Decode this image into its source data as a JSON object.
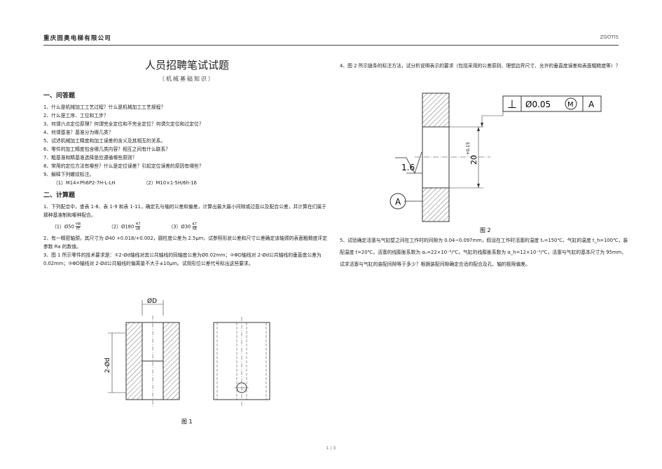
{
  "header": {
    "company": "重庆固奥电梯有限公司",
    "code": "ZGOTIS"
  },
  "title": "人员招聘笔试试题",
  "subtitle": "（机械基础知识）",
  "section1": {
    "heading": "一、问答题",
    "questions": [
      "1、什么是机械加工工艺过程？什么是机械加工工艺规程？",
      "2、什么是工序、工位和工步？",
      "3、何谓六点定位原理？何谓完全定位和不完全定位？何谓欠定位和过定位？",
      "4、何谓基准？基准分为哪几类？",
      "5、试述机械加工精度和加工误差的含义及其相互的关系。",
      "6、零件的加工精度包含哪几类内容？相互之间有什么联系？",
      "7、粗基准和精基准选择是应遵循哪些原则？",
      "8、常用的定位方法有哪些？什么是定位误差？引起定位误差的原因有哪些？",
      "9、解释下列螺纹标注。"
    ],
    "thread_items": [
      "（1）M14×Ph6P2-7H-L-LH",
      "（2）M10×1-5H/6h-16"
    ]
  },
  "section2": {
    "heading": "二、计算题",
    "q1": "1、下列配合中，查表 1-8、表 1-9 和表 1-11，确定孔与轴的公差和偏差，计算出最大最小间隙或过盈以及配合公差，并计算在们属于那种基准制和哪种配合。",
    "fits": [
      {
        "label": "（1）Ø50",
        "num": "H8",
        "den": "f7"
      },
      {
        "label": "（2）Ø180",
        "num": "H7",
        "den": "u6"
      },
      {
        "label": "（3）Ø30",
        "num": "K7",
        "den": "h6"
      }
    ],
    "q2": "2、有一精密轴颈，其尺寸为 Ø40 +0.018/+0.002，圆柱度公差为 2.5μm，试参照形状公差和尺寸公差确定该轴颈的表面粗糙度评定参数 Ra 的数值。",
    "q3": "3、图 1 所示零件的技术要求是：①2-Ød轴线对其公共轴线的同轴度公差为Ø0.02mm；②ΦD轴线对 2-Ød公共轴线的垂直度公差为 0.02mm；③ΦD轴线对 2-Ød公共轴线的偏离量不大于±10μm。试用形位公差代号标出这些要求。"
  },
  "figure1": {
    "dim_top": "ØD",
    "dim_side": "2-Ød",
    "caption": "图 1"
  },
  "right": {
    "q4": "4、图 2 所示链条的标注方法，试分析说明表示的要求（包括采用的公差原则、理想边界尺寸、允许的垂直度误差和表面粗糙度等）？",
    "q5": "5、试验确定活塞与气缸壁之间在工作时的间隙为 0.04~0.097mm，假设在工作时活塞的温度 tₛ=150℃，气缸的温度 t_h=100℃，装配温度 t=20℃，活塞的线膨胀系数为 αₛ=22×10⁻⁶/℃，气缸的线膨胀系数为 α_h=12×10⁻⁶/℃，活塞与气缸的基本尺寸为 95mm，试求活塞与气缸的装配间隙等于多少？根据装配间隙确定合适的配合及孔、轴的极限偏差。"
  },
  "figure2": {
    "fcf_symbol": "⊥",
    "fcf_tol": "Ø0.05",
    "fcf_mod": "M",
    "fcf_datum": "A",
    "dim": "20",
    "dim_tol": "+0.15",
    "roughness": "1.6",
    "datum": "A",
    "caption": "图 2"
  },
  "footer": {
    "page": "1 / 3"
  }
}
